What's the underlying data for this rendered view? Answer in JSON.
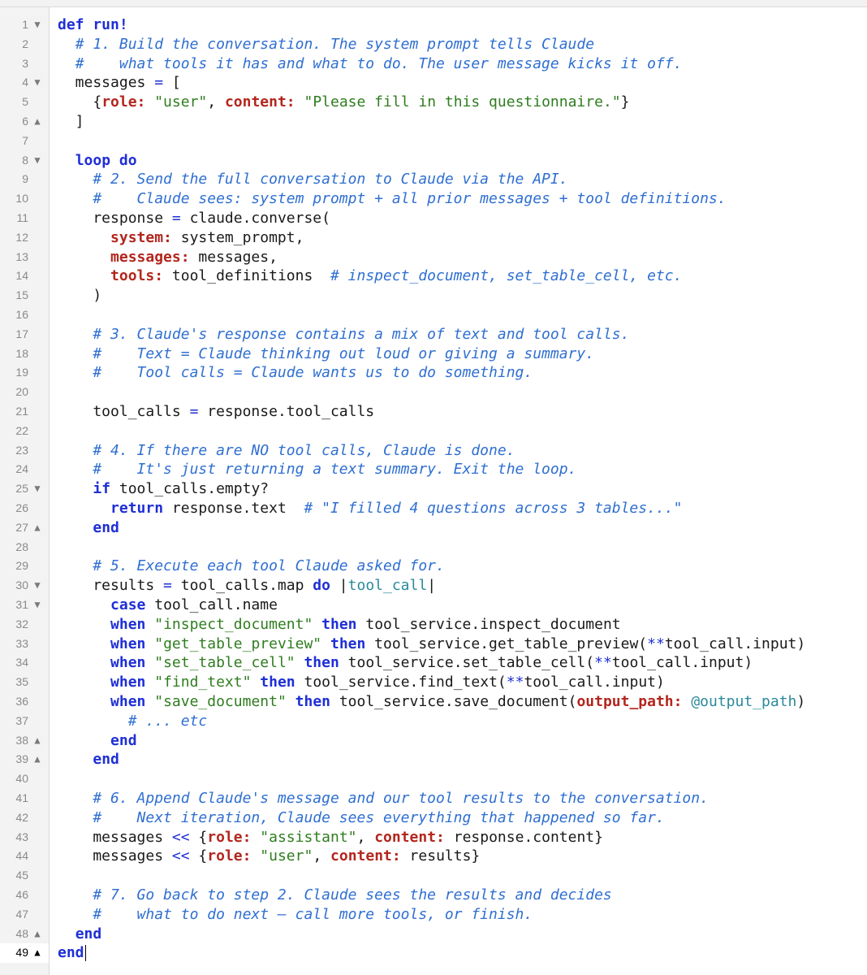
{
  "colors": {
    "keyword": "#1f2fd6",
    "symbol": "#b3261e",
    "string": "#2f7d1f",
    "comment": "#2f6fd1",
    "instance_var": "#2a8a9a",
    "line_number": "#8a8a8a",
    "gutter_bg": "#f3f3f3"
  },
  "icons": {
    "fold_open": "▼",
    "fold_close": "▲"
  },
  "cursor_line": 49,
  "lines": [
    {
      "n": "1",
      "fold": "open",
      "t": [
        [
          "kw",
          "def run!"
        ]
      ]
    },
    {
      "n": "2",
      "fold": "",
      "t": [
        [
          "plain",
          "  "
        ],
        [
          "cm",
          "# 1. Build the conversation. The system prompt tells Claude"
        ]
      ]
    },
    {
      "n": "3",
      "fold": "",
      "t": [
        [
          "plain",
          "  "
        ],
        [
          "cm",
          "#    what tools it has and what to do. The user message kicks it off."
        ]
      ]
    },
    {
      "n": "4",
      "fold": "open",
      "t": [
        [
          "plain",
          "  messages "
        ],
        [
          "op",
          "="
        ],
        [
          "plain",
          " ["
        ]
      ]
    },
    {
      "n": "5",
      "fold": "",
      "t": [
        [
          "plain",
          "    {"
        ],
        [
          "sym",
          "role:"
        ],
        [
          "plain",
          " "
        ],
        [
          "str",
          "\"user\""
        ],
        [
          "plain",
          ", "
        ],
        [
          "sym",
          "content:"
        ],
        [
          "plain",
          " "
        ],
        [
          "str",
          "\"Please fill in this questionnaire.\""
        ],
        [
          "plain",
          "}"
        ]
      ]
    },
    {
      "n": "6",
      "fold": "close",
      "t": [
        [
          "plain",
          "  ]"
        ]
      ]
    },
    {
      "n": "7",
      "fold": "",
      "t": []
    },
    {
      "n": "8",
      "fold": "open",
      "t": [
        [
          "plain",
          "  "
        ],
        [
          "kw",
          "loop do"
        ]
      ]
    },
    {
      "n": "9",
      "fold": "",
      "t": [
        [
          "plain",
          "    "
        ],
        [
          "cm",
          "# 2. Send the full conversation to Claude via the API."
        ]
      ]
    },
    {
      "n": "10",
      "fold": "",
      "t": [
        [
          "plain",
          "    "
        ],
        [
          "cm",
          "#    Claude sees: system prompt + all prior messages + tool definitions."
        ]
      ]
    },
    {
      "n": "11",
      "fold": "",
      "t": [
        [
          "plain",
          "    response "
        ],
        [
          "op",
          "="
        ],
        [
          "plain",
          " claude.converse("
        ]
      ]
    },
    {
      "n": "12",
      "fold": "",
      "t": [
        [
          "plain",
          "      "
        ],
        [
          "sym",
          "system:"
        ],
        [
          "plain",
          " system_prompt,"
        ]
      ]
    },
    {
      "n": "13",
      "fold": "",
      "t": [
        [
          "plain",
          "      "
        ],
        [
          "sym",
          "messages:"
        ],
        [
          "plain",
          " messages,"
        ]
      ]
    },
    {
      "n": "14",
      "fold": "",
      "t": [
        [
          "plain",
          "      "
        ],
        [
          "sym",
          "tools:"
        ],
        [
          "plain",
          " tool_definitions  "
        ],
        [
          "cm",
          "# inspect_document, set_table_cell, etc."
        ]
      ]
    },
    {
      "n": "15",
      "fold": "",
      "t": [
        [
          "plain",
          "    )"
        ]
      ]
    },
    {
      "n": "16",
      "fold": "",
      "t": []
    },
    {
      "n": "17",
      "fold": "",
      "t": [
        [
          "plain",
          "    "
        ],
        [
          "cm",
          "# 3. Claude's response contains a mix of text and tool calls."
        ]
      ]
    },
    {
      "n": "18",
      "fold": "",
      "t": [
        [
          "plain",
          "    "
        ],
        [
          "cm",
          "#    Text = Claude thinking out loud or giving a summary."
        ]
      ]
    },
    {
      "n": "19",
      "fold": "",
      "t": [
        [
          "plain",
          "    "
        ],
        [
          "cm",
          "#    Tool calls = Claude wants us to do something."
        ]
      ]
    },
    {
      "n": "20",
      "fold": "",
      "t": []
    },
    {
      "n": "21",
      "fold": "",
      "t": [
        [
          "plain",
          "    tool_calls "
        ],
        [
          "op",
          "="
        ],
        [
          "plain",
          " response.tool_calls"
        ]
      ]
    },
    {
      "n": "22",
      "fold": "",
      "t": []
    },
    {
      "n": "23",
      "fold": "",
      "t": [
        [
          "plain",
          "    "
        ],
        [
          "cm",
          "# 4. If there are NO tool calls, Claude is done."
        ]
      ]
    },
    {
      "n": "24",
      "fold": "",
      "t": [
        [
          "plain",
          "    "
        ],
        [
          "cm",
          "#    It's just returning a text summary. Exit the loop."
        ]
      ]
    },
    {
      "n": "25",
      "fold": "open",
      "t": [
        [
          "plain",
          "    "
        ],
        [
          "kw",
          "if"
        ],
        [
          "plain",
          " tool_calls.empty?"
        ]
      ]
    },
    {
      "n": "26",
      "fold": "",
      "t": [
        [
          "plain",
          "      "
        ],
        [
          "kw",
          "return"
        ],
        [
          "plain",
          " response.text  "
        ],
        [
          "cm",
          "# \"I filled 4 questions across 3 tables...\""
        ]
      ]
    },
    {
      "n": "27",
      "fold": "close",
      "t": [
        [
          "plain",
          "    "
        ],
        [
          "kw",
          "end"
        ]
      ]
    },
    {
      "n": "28",
      "fold": "",
      "t": []
    },
    {
      "n": "29",
      "fold": "",
      "t": [
        [
          "plain",
          "    "
        ],
        [
          "cm",
          "# 5. Execute each tool Claude asked for."
        ]
      ]
    },
    {
      "n": "30",
      "fold": "open",
      "t": [
        [
          "plain",
          "    results "
        ],
        [
          "op",
          "="
        ],
        [
          "plain",
          " tool_calls.map "
        ],
        [
          "kw",
          "do"
        ],
        [
          "plain",
          " |"
        ],
        [
          "iv",
          "tool_call"
        ],
        [
          "plain",
          "|"
        ]
      ]
    },
    {
      "n": "31",
      "fold": "open",
      "t": [
        [
          "plain",
          "      "
        ],
        [
          "kw",
          "case"
        ],
        [
          "plain",
          " tool_call.name"
        ]
      ]
    },
    {
      "n": "32",
      "fold": "",
      "t": [
        [
          "plain",
          "      "
        ],
        [
          "kw",
          "when"
        ],
        [
          "plain",
          " "
        ],
        [
          "str",
          "\"inspect_document\""
        ],
        [
          "plain",
          " "
        ],
        [
          "kw",
          "then"
        ],
        [
          "plain",
          " tool_service.inspect_document"
        ]
      ]
    },
    {
      "n": "33",
      "fold": "",
      "t": [
        [
          "plain",
          "      "
        ],
        [
          "kw",
          "when"
        ],
        [
          "plain",
          " "
        ],
        [
          "str",
          "\"get_table_preview\""
        ],
        [
          "plain",
          " "
        ],
        [
          "kw",
          "then"
        ],
        [
          "plain",
          " tool_service.get_table_preview("
        ],
        [
          "op",
          "**"
        ],
        [
          "plain",
          "tool_call.input)"
        ]
      ]
    },
    {
      "n": "34",
      "fold": "",
      "t": [
        [
          "plain",
          "      "
        ],
        [
          "kw",
          "when"
        ],
        [
          "plain",
          " "
        ],
        [
          "str",
          "\"set_table_cell\""
        ],
        [
          "plain",
          " "
        ],
        [
          "kw",
          "then"
        ],
        [
          "plain",
          " tool_service.set_table_cell("
        ],
        [
          "op",
          "**"
        ],
        [
          "plain",
          "tool_call.input)"
        ]
      ]
    },
    {
      "n": "35",
      "fold": "",
      "t": [
        [
          "plain",
          "      "
        ],
        [
          "kw",
          "when"
        ],
        [
          "plain",
          " "
        ],
        [
          "str",
          "\"find_text\""
        ],
        [
          "plain",
          " "
        ],
        [
          "kw",
          "then"
        ],
        [
          "plain",
          " tool_service.find_text("
        ],
        [
          "op",
          "**"
        ],
        [
          "plain",
          "tool_call.input)"
        ]
      ]
    },
    {
      "n": "36",
      "fold": "",
      "t": [
        [
          "plain",
          "      "
        ],
        [
          "kw",
          "when"
        ],
        [
          "plain",
          " "
        ],
        [
          "str",
          "\"save_document\""
        ],
        [
          "plain",
          " "
        ],
        [
          "kw",
          "then"
        ],
        [
          "plain",
          " tool_service.save_document("
        ],
        [
          "sym",
          "output_path:"
        ],
        [
          "plain",
          " "
        ],
        [
          "iv",
          "@output_path"
        ],
        [
          "plain",
          ")"
        ]
      ]
    },
    {
      "n": "37",
      "fold": "",
      "t": [
        [
          "plain",
          "        "
        ],
        [
          "cm",
          "# ... etc"
        ]
      ]
    },
    {
      "n": "38",
      "fold": "close",
      "t": [
        [
          "plain",
          "      "
        ],
        [
          "kw",
          "end"
        ]
      ]
    },
    {
      "n": "39",
      "fold": "close",
      "t": [
        [
          "plain",
          "    "
        ],
        [
          "kw",
          "end"
        ]
      ]
    },
    {
      "n": "40",
      "fold": "",
      "t": []
    },
    {
      "n": "41",
      "fold": "",
      "t": [
        [
          "plain",
          "    "
        ],
        [
          "cm",
          "# 6. Append Claude's message and our tool results to the conversation."
        ]
      ]
    },
    {
      "n": "42",
      "fold": "",
      "t": [
        [
          "plain",
          "    "
        ],
        [
          "cm",
          "#    Next iteration, Claude sees everything that happened so far."
        ]
      ]
    },
    {
      "n": "43",
      "fold": "",
      "t": [
        [
          "plain",
          "    messages "
        ],
        [
          "op",
          "<<"
        ],
        [
          "plain",
          " {"
        ],
        [
          "sym",
          "role:"
        ],
        [
          "plain",
          " "
        ],
        [
          "str",
          "\"assistant\""
        ],
        [
          "plain",
          ", "
        ],
        [
          "sym",
          "content:"
        ],
        [
          "plain",
          " response.content}"
        ]
      ]
    },
    {
      "n": "44",
      "fold": "",
      "t": [
        [
          "plain",
          "    messages "
        ],
        [
          "op",
          "<<"
        ],
        [
          "plain",
          " {"
        ],
        [
          "sym",
          "role:"
        ],
        [
          "plain",
          " "
        ],
        [
          "str",
          "\"user\""
        ],
        [
          "plain",
          ", "
        ],
        [
          "sym",
          "content:"
        ],
        [
          "plain",
          " results}"
        ]
      ]
    },
    {
      "n": "45",
      "fold": "",
      "t": []
    },
    {
      "n": "46",
      "fold": "",
      "t": [
        [
          "plain",
          "    "
        ],
        [
          "cm",
          "# 7. Go back to step 2. Claude sees the results and decides"
        ]
      ]
    },
    {
      "n": "47",
      "fold": "",
      "t": [
        [
          "plain",
          "    "
        ],
        [
          "cm",
          "#    what to do next — call more tools, or finish."
        ]
      ]
    },
    {
      "n": "48",
      "fold": "close",
      "t": [
        [
          "plain",
          "  "
        ],
        [
          "kw",
          "end"
        ]
      ]
    },
    {
      "n": "49",
      "fold": "close",
      "t": [
        [
          "kw",
          "end"
        ]
      ]
    }
  ]
}
